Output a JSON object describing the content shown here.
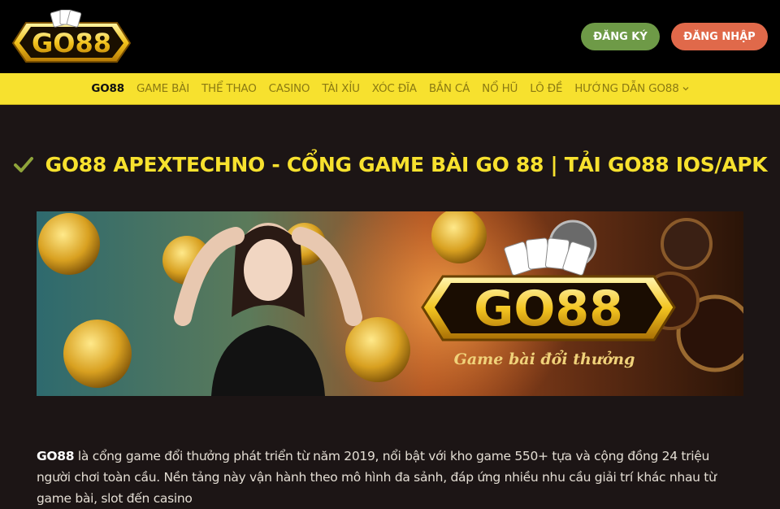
{
  "header": {
    "logo_text": "GO88",
    "register_label": "ĐĂNG KÝ",
    "login_label": "ĐĂNG NHẬP",
    "colors": {
      "register": "#6e9a47",
      "login": "#e0694a",
      "nav_bg": "#f7e12e"
    }
  },
  "nav": {
    "items": [
      {
        "label": "GO88"
      },
      {
        "label": "GAME BÀI"
      },
      {
        "label": "THỂ THAO"
      },
      {
        "label": "CASINO"
      },
      {
        "label": "TÀI XỈU"
      },
      {
        "label": "XÓC ĐĨA"
      },
      {
        "label": "BẮN CÁ"
      },
      {
        "label": "NỔ HŨ"
      },
      {
        "label": "LÔ ĐỀ"
      },
      {
        "label": "HƯỚNG DẪN GO88"
      }
    ]
  },
  "main": {
    "title": "GO88 APEXTECHNO - CỔNG GAME BÀI GO 88 | TẢI GO88 IOS/APK",
    "banner": {
      "logo_text": "GO88",
      "tagline": "Game bài đổi thưởng"
    },
    "intro_bold": "GO88",
    "intro_text": " là cổng game đổi thưởng phát triển từ năm 2019, nổi bật với kho game 550+ tựa và cộng đồng 24 triệu người chơi toàn cầu. Nền tảng này vận hành theo mô hình đa sảnh, đáp ứng nhiều nhu cầu giải trí khác nhau từ game bài, slot đến casino"
  }
}
